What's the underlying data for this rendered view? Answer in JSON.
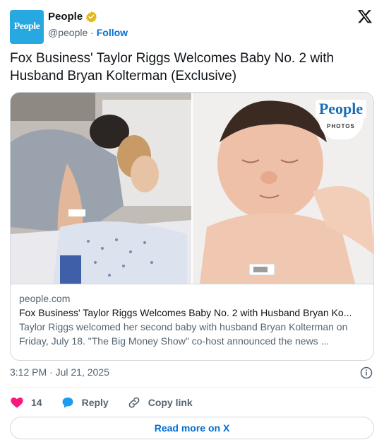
{
  "header": {
    "avatar_text": "People",
    "name": "People",
    "handle": "@people",
    "separator": "·",
    "follow_label": "Follow"
  },
  "headline": "Fox Business' Taylor Riggs Welcomes Baby No. 2 with Husband Bryan Kolterman (Exclusive)",
  "media": {
    "badge_brand": "People",
    "badge_sub": "PHOTOS"
  },
  "link_card": {
    "domain": "people.com",
    "title": "Fox Business' Taylor Riggs Welcomes Baby No. 2 with Husband Bryan Ko...",
    "description": "Taylor Riggs welcomed her second baby with husband Bryan Kolterman on Friday, July 18. \"The Big Money Show\" co-host announced the news ..."
  },
  "timestamp": "3:12 PM · Jul 21, 2025",
  "actions": {
    "likes_count": "14",
    "reply_label": "Reply",
    "copy_link_label": "Copy link"
  },
  "read_more_label": "Read more on X",
  "colors": {
    "accent_blue": "#006fd6",
    "heart_red": "#f91880",
    "verified_gold": "#e2b719",
    "avatar_blue": "#27a8e0"
  }
}
